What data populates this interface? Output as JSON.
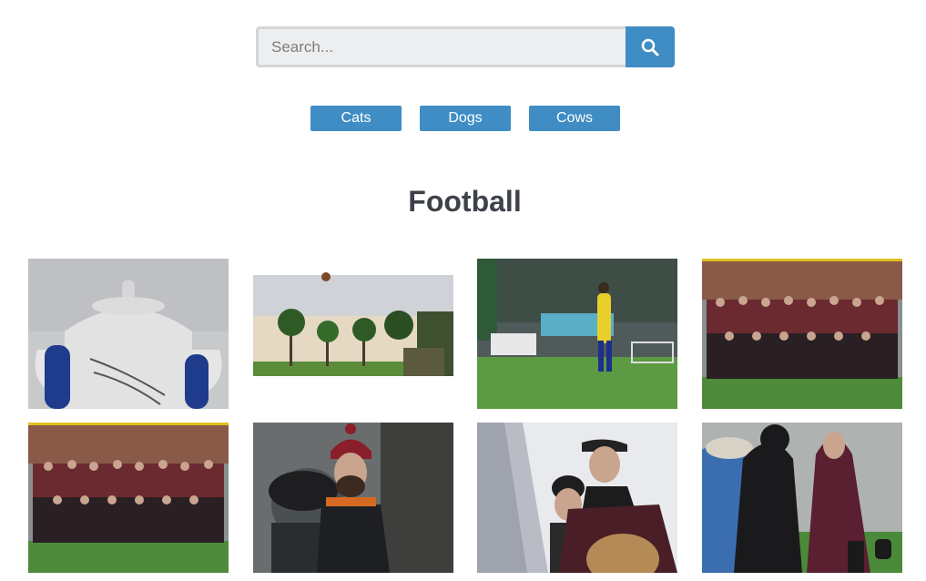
{
  "search": {
    "placeholder": "Search..."
  },
  "filters": [
    "Cats",
    "Dogs",
    "Cows"
  ],
  "page_title": "Football",
  "gallery": {
    "photos": [
      "trophy-photo",
      "palm-trees-throw-photo",
      "player-celebrating-photo",
      "team-group-photo",
      "team-group-photo-2",
      "bearded-man-beanie-photo",
      "men-in-crowd-photo",
      "players-in-rain-jackets-photo"
    ]
  }
}
